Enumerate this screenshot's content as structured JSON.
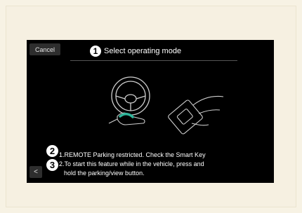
{
  "header": {
    "cancel_label": "Cancel",
    "title_marker": "1",
    "title": "Select operating mode"
  },
  "messages": [
    {
      "marker": "2",
      "text": "1.REMOTE Parking restricted. Check the Smart Key"
    },
    {
      "marker": "3",
      "text": "2.To start this feature while in the vehicle, press and"
    },
    {
      "marker": "",
      "text": "hold the parking/view button."
    }
  ],
  "footer": {
    "back_label": "<"
  },
  "icons": [
    "steering-wheel-icon",
    "hand-icon",
    "smart-key-icon"
  ],
  "colors": {
    "screen": "#000000",
    "accent": "#2fb59a",
    "background": "#f6f0e1"
  }
}
